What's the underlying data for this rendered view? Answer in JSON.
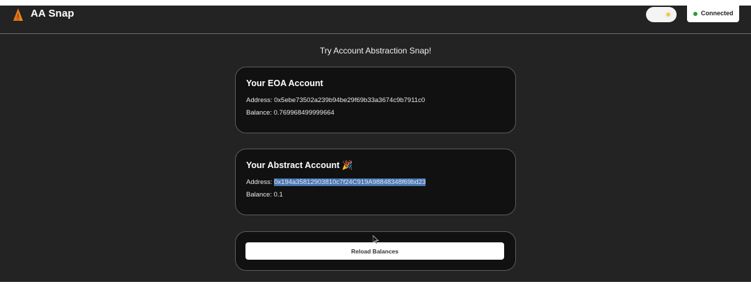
{
  "header": {
    "app_title": "AA Snap",
    "status": "Connected",
    "status_color": "#2e9b3a",
    "logo_icon": "metamask-fox-icon",
    "theme_toggle_icon": "sun-icon"
  },
  "subtitle": "Try Account Abstraction Snap!",
  "eoa_card": {
    "title": "Your EOA Account",
    "address_label": "Address:",
    "address": "0x5ebe73502a239b94be29f69b33a3674c9b7911c0",
    "balance_label": "Balance:",
    "balance": "0.769968499999664"
  },
  "abstract_card": {
    "title": "Your Abstract Account",
    "emoji": "🎉",
    "address_label": "Address:",
    "address": "0x194a35812903810c7f24C919A98848348f69bd23",
    "balance_label": "Balance:",
    "balance": "0.1"
  },
  "reload_button": {
    "label": "Reload Balances"
  }
}
